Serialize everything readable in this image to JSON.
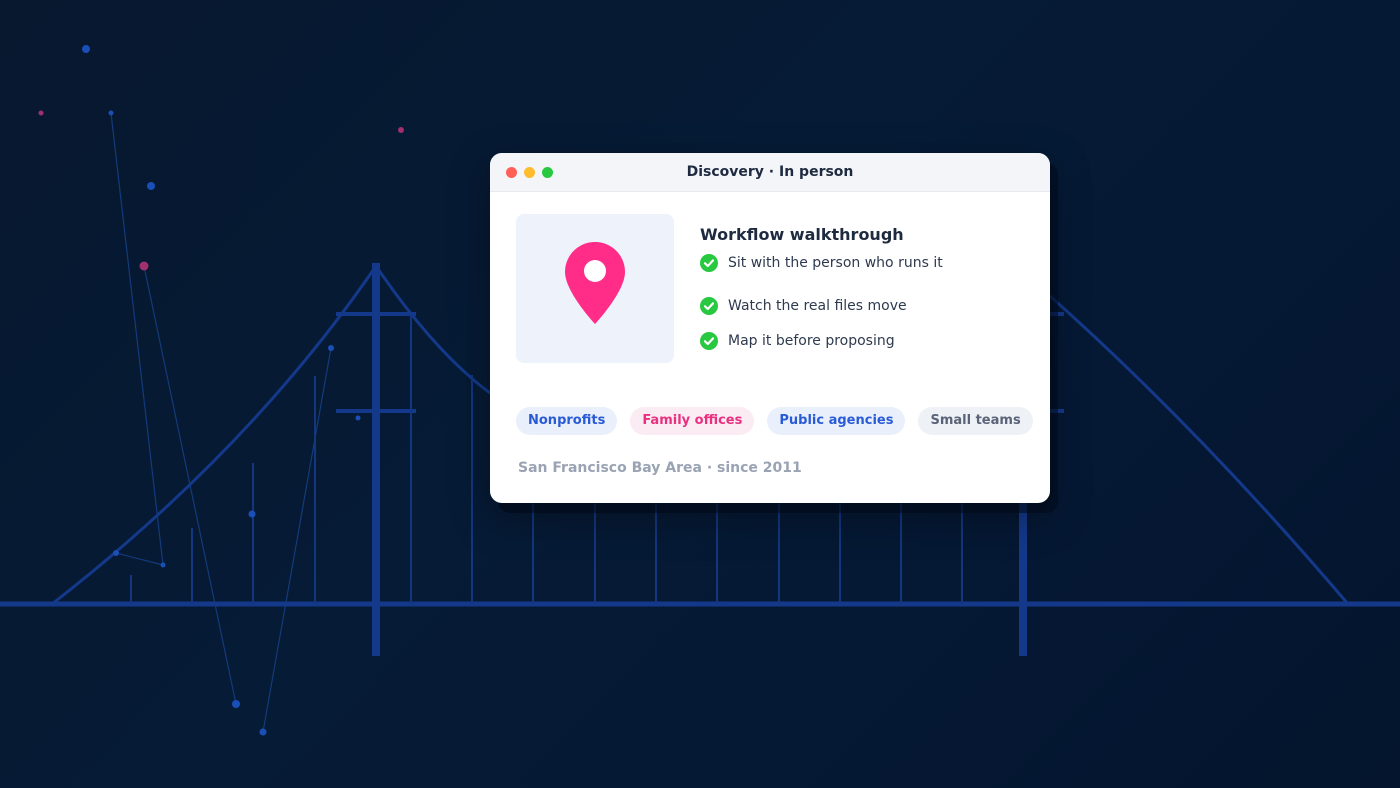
{
  "window": {
    "title": "Discovery · In person"
  },
  "media": {
    "icon": "map-pin-icon",
    "pin_color": "#ff2d87"
  },
  "content": {
    "heading": "Workflow walkthrough",
    "checklist": [
      "Sit with the person who runs it",
      "Watch the real files move",
      "Map it before proposing"
    ]
  },
  "tags": [
    {
      "label": "Nonprofits",
      "color": "#2a5bd7"
    },
    {
      "label": "Family offices",
      "color": "#e9317f"
    },
    {
      "label": "Public agencies",
      "color": "#2a5bd7"
    },
    {
      "label": "Small teams",
      "color": "#5a6478"
    }
  ],
  "footer": {
    "text": "San Francisco Bay Area · since 2011"
  },
  "colors": {
    "background": "#061b36",
    "bridge_line": "#12377f",
    "check_green": "#28c840"
  }
}
